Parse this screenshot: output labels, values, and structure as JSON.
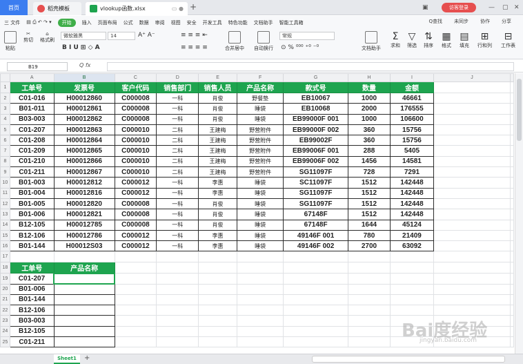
{
  "tabs": {
    "home": "首页",
    "template": "稻壳模板",
    "file": "vlookup函数.xlsx"
  },
  "login": "访客登录",
  "menu": [
    "三 文件",
    "开始",
    "插入",
    "页面布局",
    "公式",
    "数据",
    "审阅",
    "视图",
    "安全",
    "开发工具",
    "特色功能",
    "文档助手",
    "智能工具箱"
  ],
  "menu_right": [
    "Q查找",
    "未同步",
    "协作",
    "分享"
  ],
  "ribbon": {
    "paste": "粘贴",
    "cut": "剪切",
    "copy": "复制",
    "format_painter": "格式刷",
    "font": "微软雅黑",
    "size": "14",
    "number_format": "常规",
    "merge": "合并居中",
    "wrap": "自动换行",
    "docs": "文档助手",
    "sum": "求和",
    "filter": "筛选",
    "sort": "排序",
    "format": "格式",
    "fill": "填充",
    "rowcol": "行和列",
    "sheet": "工作表"
  },
  "namebox": "B19",
  "columns": [
    "A",
    "B",
    "C",
    "D",
    "E",
    "F",
    "G",
    "H",
    "I",
    "J"
  ],
  "headers": [
    "工单号",
    "发票号",
    "客户代码",
    "销售部门",
    "销售人员",
    "产品名称",
    "款式号",
    "数量",
    "金额"
  ],
  "rows": [
    [
      "C01-016",
      "H00012860",
      "C000008",
      "一科",
      "肖俊",
      "野餐垫",
      "EB10067",
      "1000",
      "46661"
    ],
    [
      "B01-011",
      "H00012861",
      "C000008",
      "一科",
      "肖俊",
      "睡袋",
      "EB10068",
      "2000",
      "176555"
    ],
    [
      "B03-003",
      "H00012862",
      "C000008",
      "一科",
      "肖俊",
      "睡袋",
      "EB99000F 001",
      "1000",
      "106600"
    ],
    [
      "C01-207",
      "H00012863",
      "C000010",
      "二科",
      "王建梅",
      "野营附件",
      "EB99000F 002",
      "360",
      "15756"
    ],
    [
      "C01-208",
      "H00012864",
      "C000010",
      "二科",
      "王建梅",
      "野营附件",
      "EB99002F",
      "360",
      "15756"
    ],
    [
      "C01-209",
      "H00012865",
      "C000010",
      "二科",
      "王建梅",
      "野营附件",
      "EB99006F 001",
      "288",
      "5405"
    ],
    [
      "C01-210",
      "H00012866",
      "C000010",
      "二科",
      "王建梅",
      "野营附件",
      "EB99006F 002",
      "1456",
      "14581"
    ],
    [
      "C01-211",
      "H00012867",
      "C000010",
      "二科",
      "王建梅",
      "野营附件",
      "SG11097F",
      "728",
      "7291"
    ],
    [
      "B01-003",
      "H00012812",
      "C000012",
      "一科",
      "李惠",
      "睡袋",
      "SC11097F",
      "1512",
      "142448"
    ],
    [
      "B01-004",
      "H00012816",
      "C000012",
      "一科",
      "李惠",
      "睡袋",
      "SG11097F",
      "1512",
      "142448"
    ],
    [
      "B01-005",
      "H00012820",
      "C000008",
      "一科",
      "肖俊",
      "睡袋",
      "SG11097F",
      "1512",
      "142448"
    ],
    [
      "B01-006",
      "H00012821",
      "C000008",
      "一科",
      "肖俊",
      "睡袋",
      "67148F",
      "1512",
      "142448"
    ],
    [
      "B12-105",
      "H00012785",
      "C000008",
      "一科",
      "肖俊",
      "睡袋",
      "67148F",
      "1644",
      "45124"
    ],
    [
      "B12-106",
      "H00012786",
      "C000012",
      "一科",
      "李惠",
      "睡袋",
      "49146F 001",
      "780",
      "21409"
    ],
    [
      "B01-144",
      "H00012S03",
      "C000012",
      "一科",
      "李惠",
      "睡袋",
      "49146F 002",
      "2700",
      "63092"
    ]
  ],
  "lookup": {
    "headers": [
      "工单号",
      "产品名称"
    ],
    "ids": [
      "C01-207",
      "B01-006",
      "B01-144",
      "B12-106",
      "B03-003",
      "B12-105",
      "C01-211"
    ]
  },
  "sheet_tab": "Sheet1",
  "watermark": "Bai度经验",
  "watermark_sub": "jingyan.baidu.com"
}
